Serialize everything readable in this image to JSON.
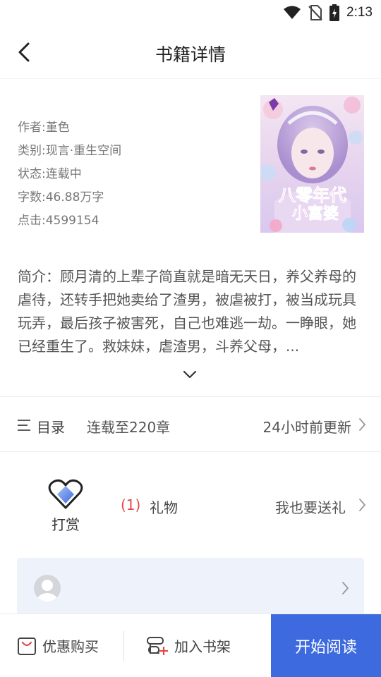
{
  "status_bar": {
    "time": "2:13",
    "icons": [
      "wifi-icon",
      "no-sim-icon",
      "battery-charging-icon"
    ]
  },
  "header": {
    "back_icon": "back-arrow-icon",
    "title": "书籍详情"
  },
  "book": {
    "author": "作者:堇色",
    "category": "类别:现言·重生空间",
    "status": "状态:连载中",
    "word_count": "字数:46.88万字",
    "clicks": "点击:4599154",
    "cover_title": "八零年代小富婆"
  },
  "intro": {
    "text": "简介：顾月清的上辈子简直就是暗无天日，养父养母的虐待，还转手把她卖给了渣男，被虐被打，被当成玩具玩弄，最后孩子被害死，自己也难逃一劫。一睁眼，她已经重生了。救妹妹，虐渣男，斗养父母，...",
    "expand_icon": "chevron-down-icon"
  },
  "catalog": {
    "label": "目录",
    "serial": "连载至220章",
    "update": "24小时前更新"
  },
  "reward": {
    "label": "打赏",
    "count": "(1)",
    "gift_label": "礼物",
    "send_label": "我也要送礼"
  },
  "bottom_bar": {
    "buy_label": "优惠购买",
    "shelf_label": "加入书架",
    "read_label": "开始阅读"
  },
  "colors": {
    "accent": "#3d6adf",
    "count_red": "#e04848",
    "card_bg": "#eef2fb"
  }
}
